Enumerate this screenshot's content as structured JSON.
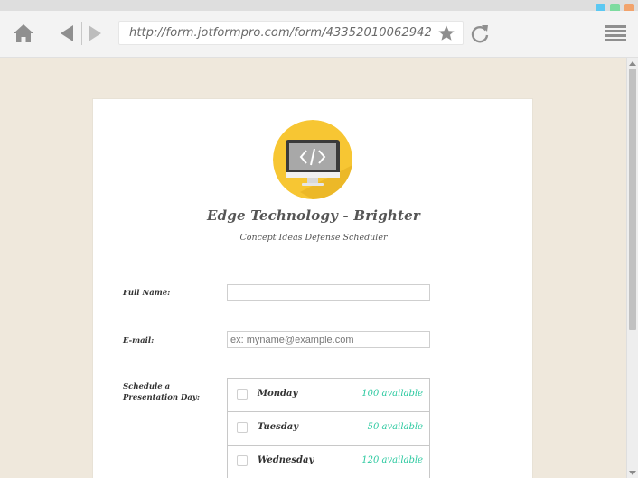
{
  "browser": {
    "url": "http://form.jotformpro.com/form/43352010062942",
    "window_buttons": [
      "blue",
      "green",
      "orange"
    ],
    "icons": {
      "home": "home-icon",
      "back": "back-arrow-icon",
      "forward": "forward-arrow-icon",
      "bookmark": "star-icon",
      "reload": "reload-icon",
      "menu": "hamburger-menu-icon"
    }
  },
  "form": {
    "logo_icon": "monitor-code-icon",
    "title": "Edge Technology - Brighter",
    "subtitle": "Concept Ideas Defense Scheduler",
    "fields": {
      "full_name": {
        "label": "Full Name:",
        "value": "",
        "placeholder": ""
      },
      "email": {
        "label": "E-mail:",
        "value": "",
        "placeholder": "ex: myname@example.com"
      },
      "schedule": {
        "label": "Schedule a Presentation Day:",
        "options": [
          {
            "day": "Monday",
            "available": "100 available"
          },
          {
            "day": "Tuesday",
            "available": "50 available"
          },
          {
            "day": "Wednesday",
            "available": "120 available"
          }
        ]
      }
    }
  },
  "colors": {
    "page_background": "#efe8dc",
    "logo_circle": "#f7c633",
    "availability_text": "#2cc9a0"
  }
}
